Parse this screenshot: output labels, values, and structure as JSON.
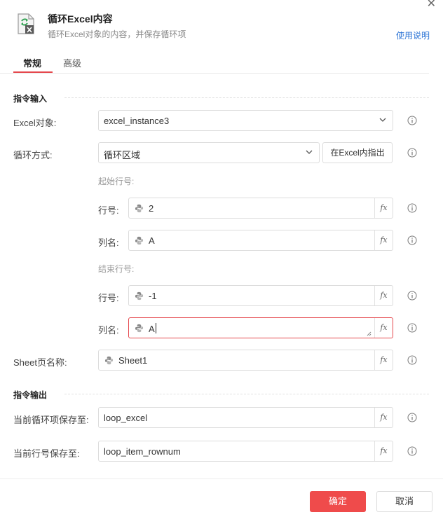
{
  "dialog": {
    "title": "循环Excel内容",
    "subtitle": "循环Excel对象的内容，并保存循环项",
    "help_link": "使用说明"
  },
  "tabs": [
    {
      "label": "常规",
      "active": true
    },
    {
      "label": "高级",
      "active": false
    }
  ],
  "input_section": {
    "title": "指令输入",
    "excel_object": {
      "label": "Excel对象:",
      "value": "excel_instance3"
    },
    "loop_mode": {
      "label": "循环方式:",
      "value": "循环区域",
      "locate_button": "在Excel内指出"
    },
    "start_row": {
      "group_label": "起始行号:",
      "row_label": "行号:",
      "row_value": "2",
      "col_label": "列名:",
      "col_value": "A"
    },
    "end_row": {
      "group_label": "结束行号:",
      "row_label": "行号:",
      "row_value": "-1",
      "col_label": "列名:",
      "col_value": "A"
    },
    "sheet_name": {
      "label": "Sheet页名称:",
      "value": "Sheet1"
    }
  },
  "output_section": {
    "title": "指令输出",
    "loop_item": {
      "label": "当前循环项保存至:",
      "value": "loop_excel"
    },
    "row_num": {
      "label": "当前行号保存至:",
      "value": "loop_item_rownum"
    }
  },
  "fx_label": "fx",
  "footer": {
    "confirm": "确定",
    "cancel": "取消"
  },
  "colors": {
    "accent": "#ef4b4b",
    "link": "#2f76d6",
    "error_border": "#e5484d"
  }
}
